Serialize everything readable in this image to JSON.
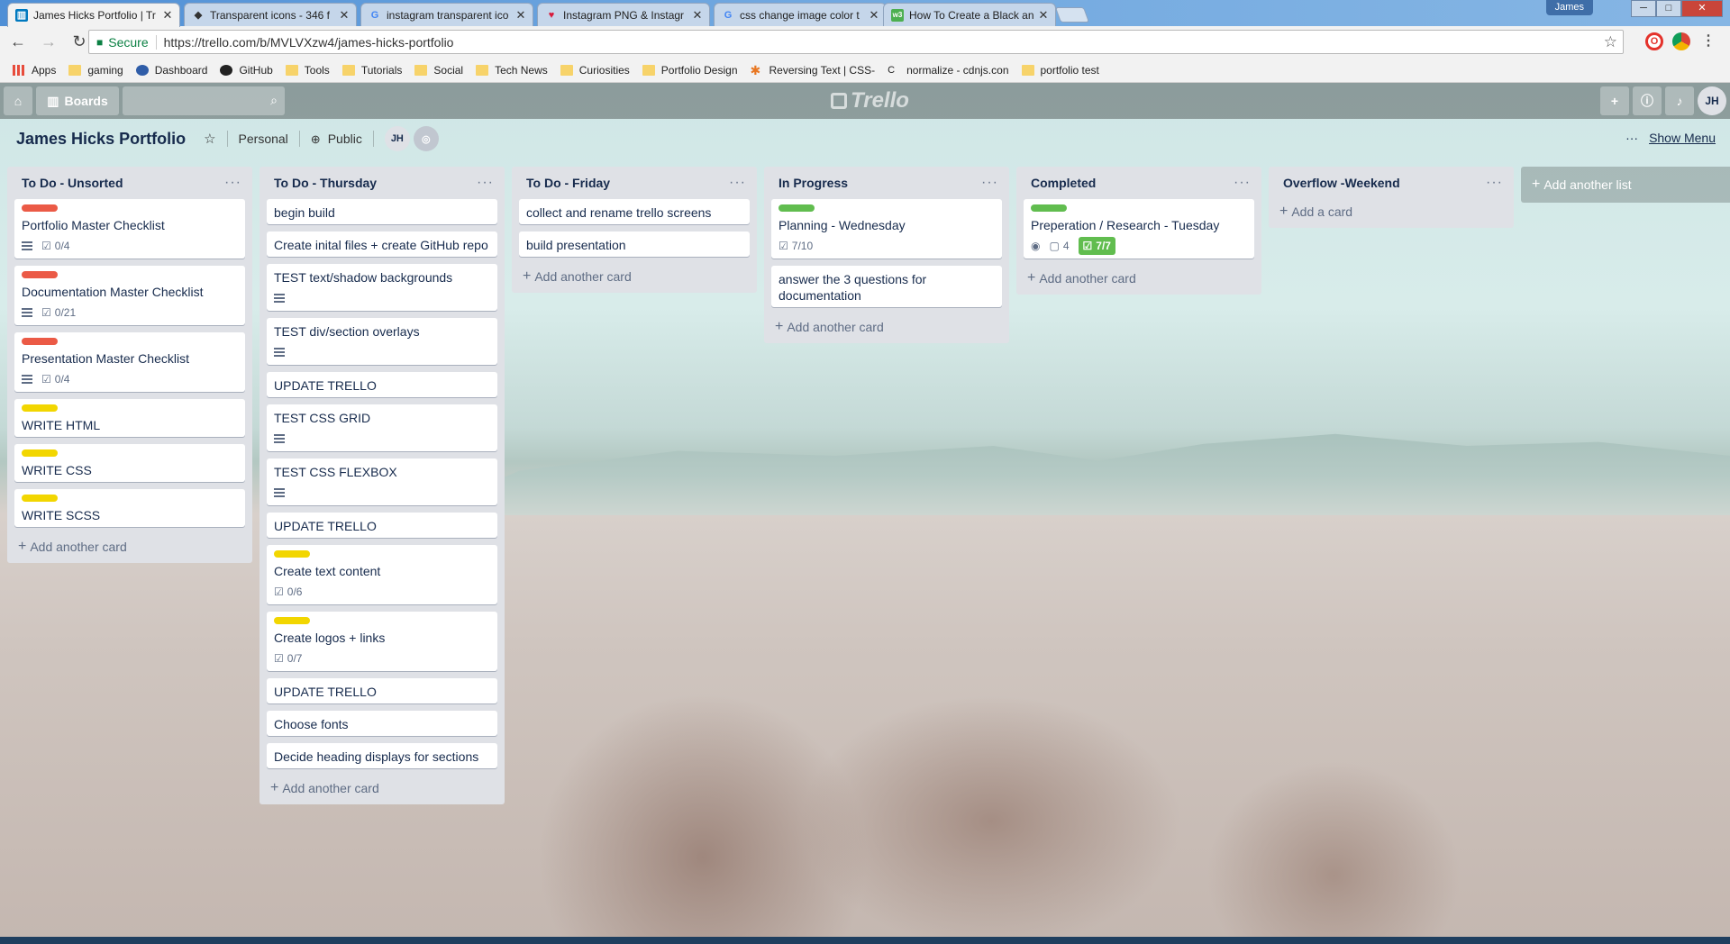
{
  "browser": {
    "tabs": [
      {
        "title": "James Hicks Portfolio | Tr",
        "active": true,
        "icon": "trello-icon"
      },
      {
        "title": "Transparent icons - 346 f",
        "active": false,
        "icon": "drop-icon"
      },
      {
        "title": "instagram transparent ico",
        "active": false,
        "icon": "google-icon"
      },
      {
        "title": "Instagram PNG & Instagr",
        "active": false,
        "icon": "heart-icon"
      },
      {
        "title": "css change image color t",
        "active": false,
        "icon": "google-icon"
      },
      {
        "title": "How To Create a Black an",
        "active": false,
        "icon": "w3schools-icon"
      }
    ],
    "user": "James",
    "secure_label": "Secure",
    "url": "https://trello.com/b/MVLVXzw4/james-hicks-portfolio",
    "bookmarks": [
      {
        "label": "Apps",
        "icon": "apps-icon"
      },
      {
        "label": "gaming",
        "icon": "folder-icon"
      },
      {
        "label": "Dashboard",
        "icon": "dashboard-icon"
      },
      {
        "label": "GitHub",
        "icon": "github-icon"
      },
      {
        "label": "Tools",
        "icon": "folder-icon"
      },
      {
        "label": "Tutorials",
        "icon": "folder-icon"
      },
      {
        "label": "Social",
        "icon": "folder-icon"
      },
      {
        "label": "Tech News",
        "icon": "folder-icon"
      },
      {
        "label": "Curiosities",
        "icon": "folder-icon"
      },
      {
        "label": "Portfolio Design",
        "icon": "folder-icon"
      },
      {
        "label": "Reversing Text | CSS-",
        "icon": "asterisk-icon"
      },
      {
        "label": "normalize - cdnjs.con",
        "icon": "cdnjs-icon"
      },
      {
        "label": "portfolio test",
        "icon": "folder-icon"
      }
    ]
  },
  "header": {
    "boards_label": "Boards",
    "logo": "Trello",
    "avatar": "JH"
  },
  "board": {
    "title": "James Hicks Portfolio",
    "team": "Personal",
    "visibility": "Public",
    "member": "JH",
    "show_menu": "Show Menu",
    "add_list": "Add another list"
  },
  "colors": {
    "red": "#eb5a46",
    "yellow": "#f2d600",
    "green": "#61bd4f"
  },
  "lists": [
    {
      "name": "To Do - Unsorted",
      "add": "Add another card",
      "cards": [
        {
          "title": "Portfolio Master Checklist",
          "label": "red",
          "desc": true,
          "check": "0/4"
        },
        {
          "title": "Documentation Master Checklist",
          "label": "red",
          "desc": true,
          "check": "0/21"
        },
        {
          "title": "Presentation Master Checklist",
          "label": "red",
          "desc": true,
          "check": "0/4"
        },
        {
          "title": "WRITE HTML",
          "label": "yellow"
        },
        {
          "title": "WRITE CSS",
          "label": "yellow"
        },
        {
          "title": "WRITE SCSS",
          "label": "yellow"
        }
      ]
    },
    {
      "name": "To Do - Thursday",
      "add": "Add another card",
      "cards": [
        {
          "title": "begin build"
        },
        {
          "title": "Create inital files + create GitHub repo"
        },
        {
          "title": "TEST text/shadow backgrounds",
          "desc": true
        },
        {
          "title": "TEST div/section overlays",
          "desc": true
        },
        {
          "title": "UPDATE TRELLO"
        },
        {
          "title": "TEST CSS GRID",
          "desc": true
        },
        {
          "title": "TEST CSS FLEXBOX",
          "desc": true
        },
        {
          "title": "UPDATE TRELLO"
        },
        {
          "title": "Create text content",
          "label": "yellow",
          "check": "0/6"
        },
        {
          "title": "Create logos + links",
          "label": "yellow",
          "check": "0/7"
        },
        {
          "title": "UPDATE TRELLO"
        },
        {
          "title": "Choose fonts"
        },
        {
          "title": "Decide heading displays for sections"
        }
      ]
    },
    {
      "name": "To Do - Friday",
      "add": "Add another card",
      "cards": [
        {
          "title": "collect and rename trello screens"
        },
        {
          "title": "build presentation"
        }
      ]
    },
    {
      "name": "In Progress",
      "add": "Add another card",
      "cards": [
        {
          "title": "Planning - Wednesday",
          "label": "green",
          "check": "7/10"
        },
        {
          "title": "answer the 3 questions for documentation"
        }
      ]
    },
    {
      "name": "Completed",
      "add": "Add another card",
      "cards": [
        {
          "title": "Preperation / Research - Tuesday",
          "label": "green",
          "watch": true,
          "comments": "4",
          "check": "7/7",
          "check_done": true
        }
      ]
    },
    {
      "name": "Overflow -Weekend",
      "add": "Add a card",
      "cards": []
    }
  ]
}
